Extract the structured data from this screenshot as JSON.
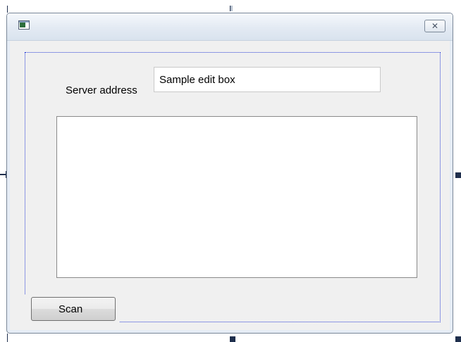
{
  "window": {
    "close_glyph": "✕",
    "icon": "app-window-icon"
  },
  "form": {
    "server_label": "Server address",
    "server_value": "Sample edit box",
    "scan_label": "Scan"
  },
  "colors": {
    "selection_frame": "#2b3fd6",
    "window_bg": "#f0f0f0",
    "titlebar": "#dfe7f1"
  }
}
